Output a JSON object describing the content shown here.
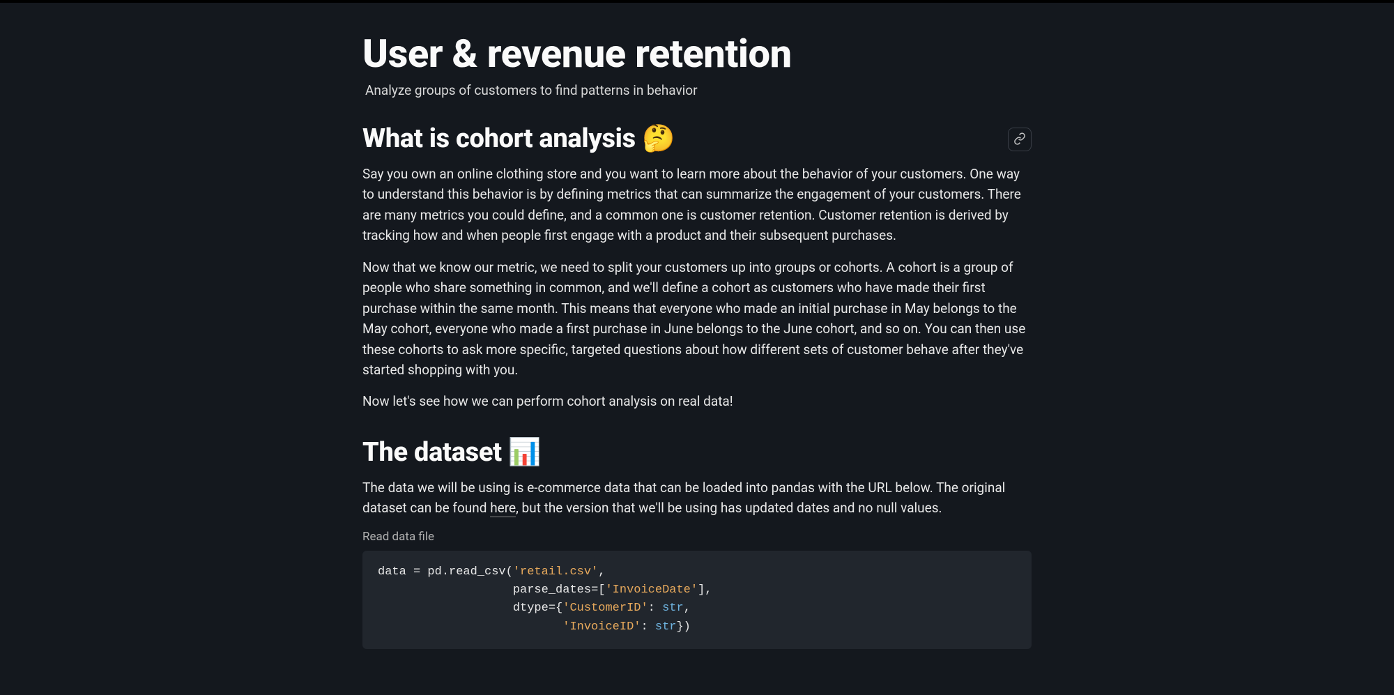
{
  "title": "User & revenue retention",
  "subtitle": "Analyze groups of customers to find patterns in behavior",
  "heading1": "What is cohort analysis 🤔",
  "para1": "Say you own an online clothing store and you want to learn more about the behavior of your customers. One way to understand this behavior is by defining metrics that can summarize the engagement of your customers. There are many metrics you could define, and a common one is customer retention. Customer retention is derived by tracking how and when people first engage with a product and their subsequent purchases.",
  "para2": "Now that we know our metric, we need to split your customers up into groups or cohorts. A cohort is a group of people who share something in common, and we'll define a cohort as customers who have made their first purchase within the same month. This means that everyone who made an initial purchase in May belongs to the May cohort, everyone who made a first purchase in June belongs to the June cohort, and so on. You can then use these cohorts to ask more specific, targeted questions about how different sets of customer behave after they've started shopping with you.",
  "para3": "Now let's see how we can perform cohort analysis on real data!",
  "heading2": "The dataset 📊",
  "para4a": "The data we will be using is e-commerce data that can be loaded into pandas with the URL below. The original dataset can be found ",
  "para4link": "here",
  "para4b": ", but the version that we'll be using has updated dates and no null values.",
  "codeCaption": "Read data file",
  "code": {
    "l1_a": "data ",
    "l1_b": "=",
    "l1_c": " pd.read_csv(",
    "l1_d": "'retail.csv'",
    "l1_e": ",",
    "l2_a": "                   parse_dates",
    "l2_b": "=",
    "l2_c": "[",
    "l2_d": "'InvoiceDate'",
    "l2_e": "],",
    "l3_a": "                   dtype",
    "l3_b": "=",
    "l3_c": "{",
    "l3_d": "'CustomerID'",
    "l3_e": ": ",
    "l3_f": "str",
    "l3_g": ",",
    "l4_a": "                          ",
    "l4_b": "'InvoiceID'",
    "l4_c": ": ",
    "l4_d": "str",
    "l4_e": "})"
  }
}
